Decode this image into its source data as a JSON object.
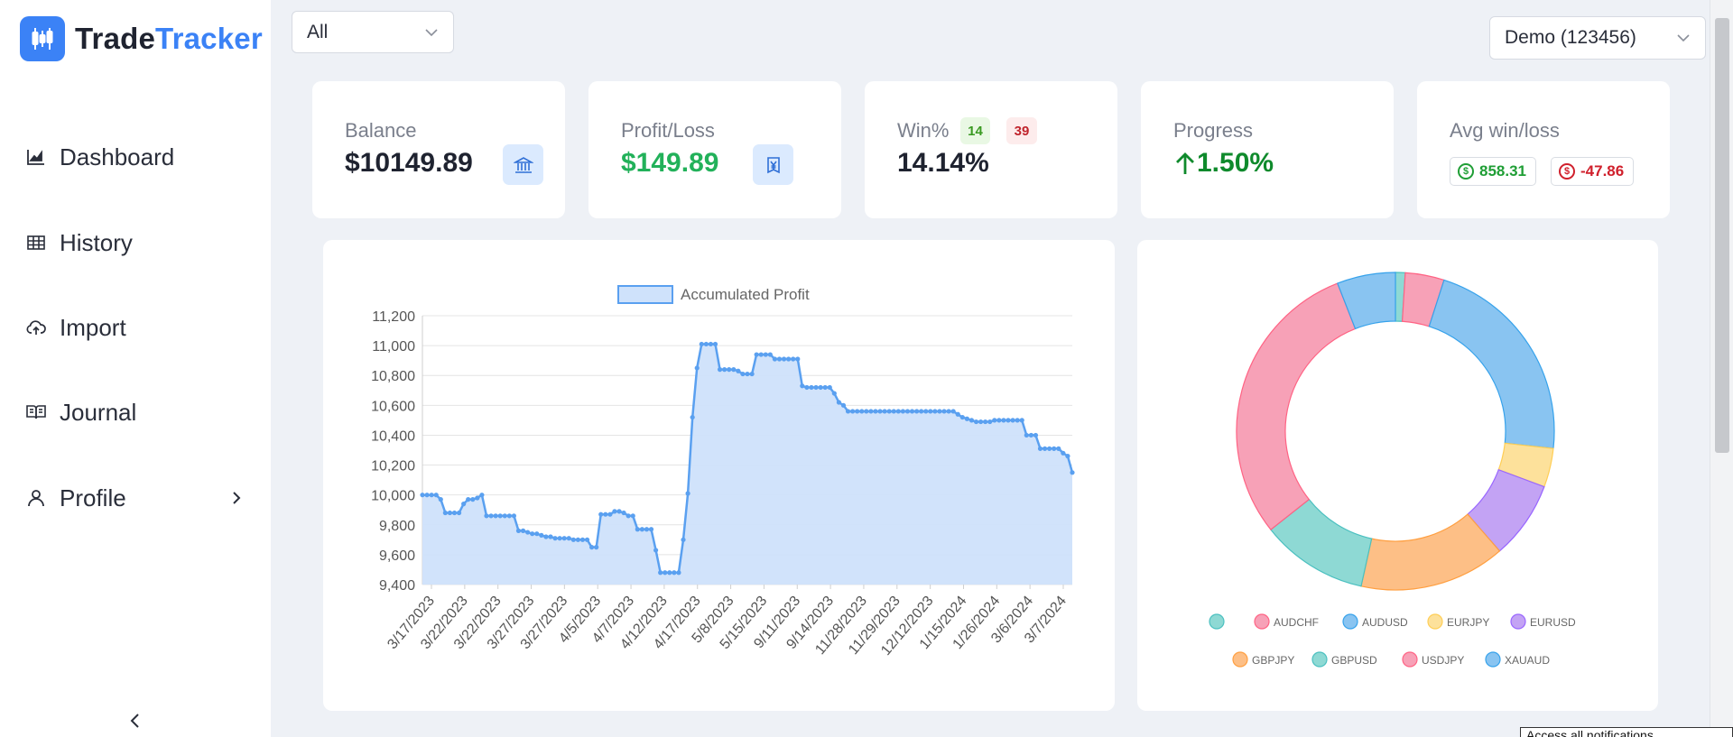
{
  "app": {
    "name_part1": "Trade",
    "name_part2": "Tracker"
  },
  "sidebar": {
    "items": [
      {
        "label": "Dashboard",
        "icon": "chart-icon"
      },
      {
        "label": "History",
        "icon": "table-icon"
      },
      {
        "label": "Import",
        "icon": "cloud-upload-icon"
      },
      {
        "label": "Journal",
        "icon": "book-icon"
      },
      {
        "label": "Profile",
        "icon": "user-icon"
      }
    ]
  },
  "header": {
    "filter_value": "All",
    "account_value": "Demo (123456)"
  },
  "stats": {
    "balance": {
      "label": "Balance",
      "value": "$10149.89"
    },
    "profit_loss": {
      "label": "Profit/Loss",
      "value": "$149.89"
    },
    "win": {
      "label": "Win%",
      "wins": "14",
      "losses": "39",
      "value": "14.14%"
    },
    "progress": {
      "label": "Progress",
      "value": "1.50%"
    },
    "avg": {
      "label": "Avg win/loss",
      "win": "858.31",
      "loss": "-47.86"
    }
  },
  "colors": {
    "accent": "#3b82f6",
    "green": "#22b15a",
    "red": "#d0202c"
  },
  "chart_data": [
    {
      "type": "area",
      "legend": [
        "Accumulated Profit"
      ],
      "legend_position": "top",
      "grid": true,
      "ylim": [
        9400,
        11200
      ],
      "yticks": [
        "11,200",
        "11,000",
        "10,800",
        "10,600",
        "10,400",
        "10,200",
        "10,000",
        "9,800",
        "9,600",
        "9,400"
      ],
      "xticks": [
        "3/17/2023",
        "3/22/2023",
        "3/22/2023",
        "3/27/2023",
        "3/27/2023",
        "4/5/2023",
        "4/7/2023",
        "4/12/2023",
        "4/17/2023",
        "5/8/2023",
        "5/15/2023",
        "9/11/2023",
        "9/14/2023",
        "11/28/2023",
        "11/29/2023",
        "12/12/2023",
        "1/15/2024",
        "1/26/2024",
        "3/6/2024",
        "3/7/2024"
      ],
      "series": [
        {
          "name": "Accumulated Profit",
          "color": "#5aa0f0",
          "fill": "#cfe2fb",
          "values": [
            10000,
            10000,
            10000,
            10000,
            9970,
            9880,
            9880,
            9880,
            9880,
            9940,
            9970,
            9970,
            9980,
            10000,
            9860,
            9860,
            9860,
            9860,
            9860,
            9860,
            9860,
            9760,
            9760,
            9750,
            9740,
            9740,
            9730,
            9720,
            9720,
            9710,
            9710,
            9710,
            9710,
            9700,
            9700,
            9700,
            9700,
            9650,
            9650,
            9870,
            9870,
            9870,
            9890,
            9890,
            9880,
            9860,
            9860,
            9770,
            9770,
            9770,
            9770,
            9630,
            9480,
            9480,
            9480,
            9480,
            9480,
            9700,
            10010,
            10520,
            10850,
            11010,
            11010,
            11010,
            11010,
            10840,
            10840,
            10840,
            10840,
            10830,
            10810,
            10810,
            10810,
            10940,
            10940,
            10940,
            10940,
            10910,
            10910,
            10910,
            10910,
            10910,
            10910,
            10730,
            10720,
            10720,
            10720,
            10720,
            10720,
            10720,
            10680,
            10620,
            10600,
            10560,
            10560,
            10560,
            10560,
            10560,
            10560,
            10560,
            10560,
            10560,
            10560,
            10560,
            10560,
            10560,
            10560,
            10560,
            10560,
            10560,
            10560,
            10560,
            10560,
            10560,
            10560,
            10560,
            10560,
            10540,
            10520,
            10510,
            10500,
            10490,
            10490,
            10490,
            10490,
            10500,
            10500,
            10500,
            10500,
            10500,
            10500,
            10500,
            10400,
            10400,
            10400,
            10310,
            10310,
            10310,
            10310,
            10310,
            10280,
            10260,
            10150
          ]
        }
      ]
    },
    {
      "type": "pie",
      "donut": true,
      "legend_position": "bottom",
      "labels": [
        "",
        "AUDCHF",
        "AUDUSD",
        "EURJPY",
        "EURUSD",
        "GBPJPY",
        "GBPUSD",
        "USDJPY",
        "XAUAUD"
      ],
      "values": [
        1,
        4,
        22,
        4,
        8,
        15,
        11,
        30,
        6
      ],
      "colors": [
        "#8ed9d4",
        "#f7a1b7",
        "#89c4f1",
        "#fde19b",
        "#c3a3f4",
        "#fdbf86",
        "#8ed9d4",
        "#f7a1b7",
        "#89c4f1"
      ],
      "borders": [
        "#4bc0c0",
        "#ff6384",
        "#36a2eb",
        "#ffce56",
        "#9966ff",
        "#ff9f40",
        "#4bc0c0",
        "#ff6384",
        "#36a2eb"
      ]
    }
  ],
  "toast": {
    "text": "Access all notifications"
  }
}
